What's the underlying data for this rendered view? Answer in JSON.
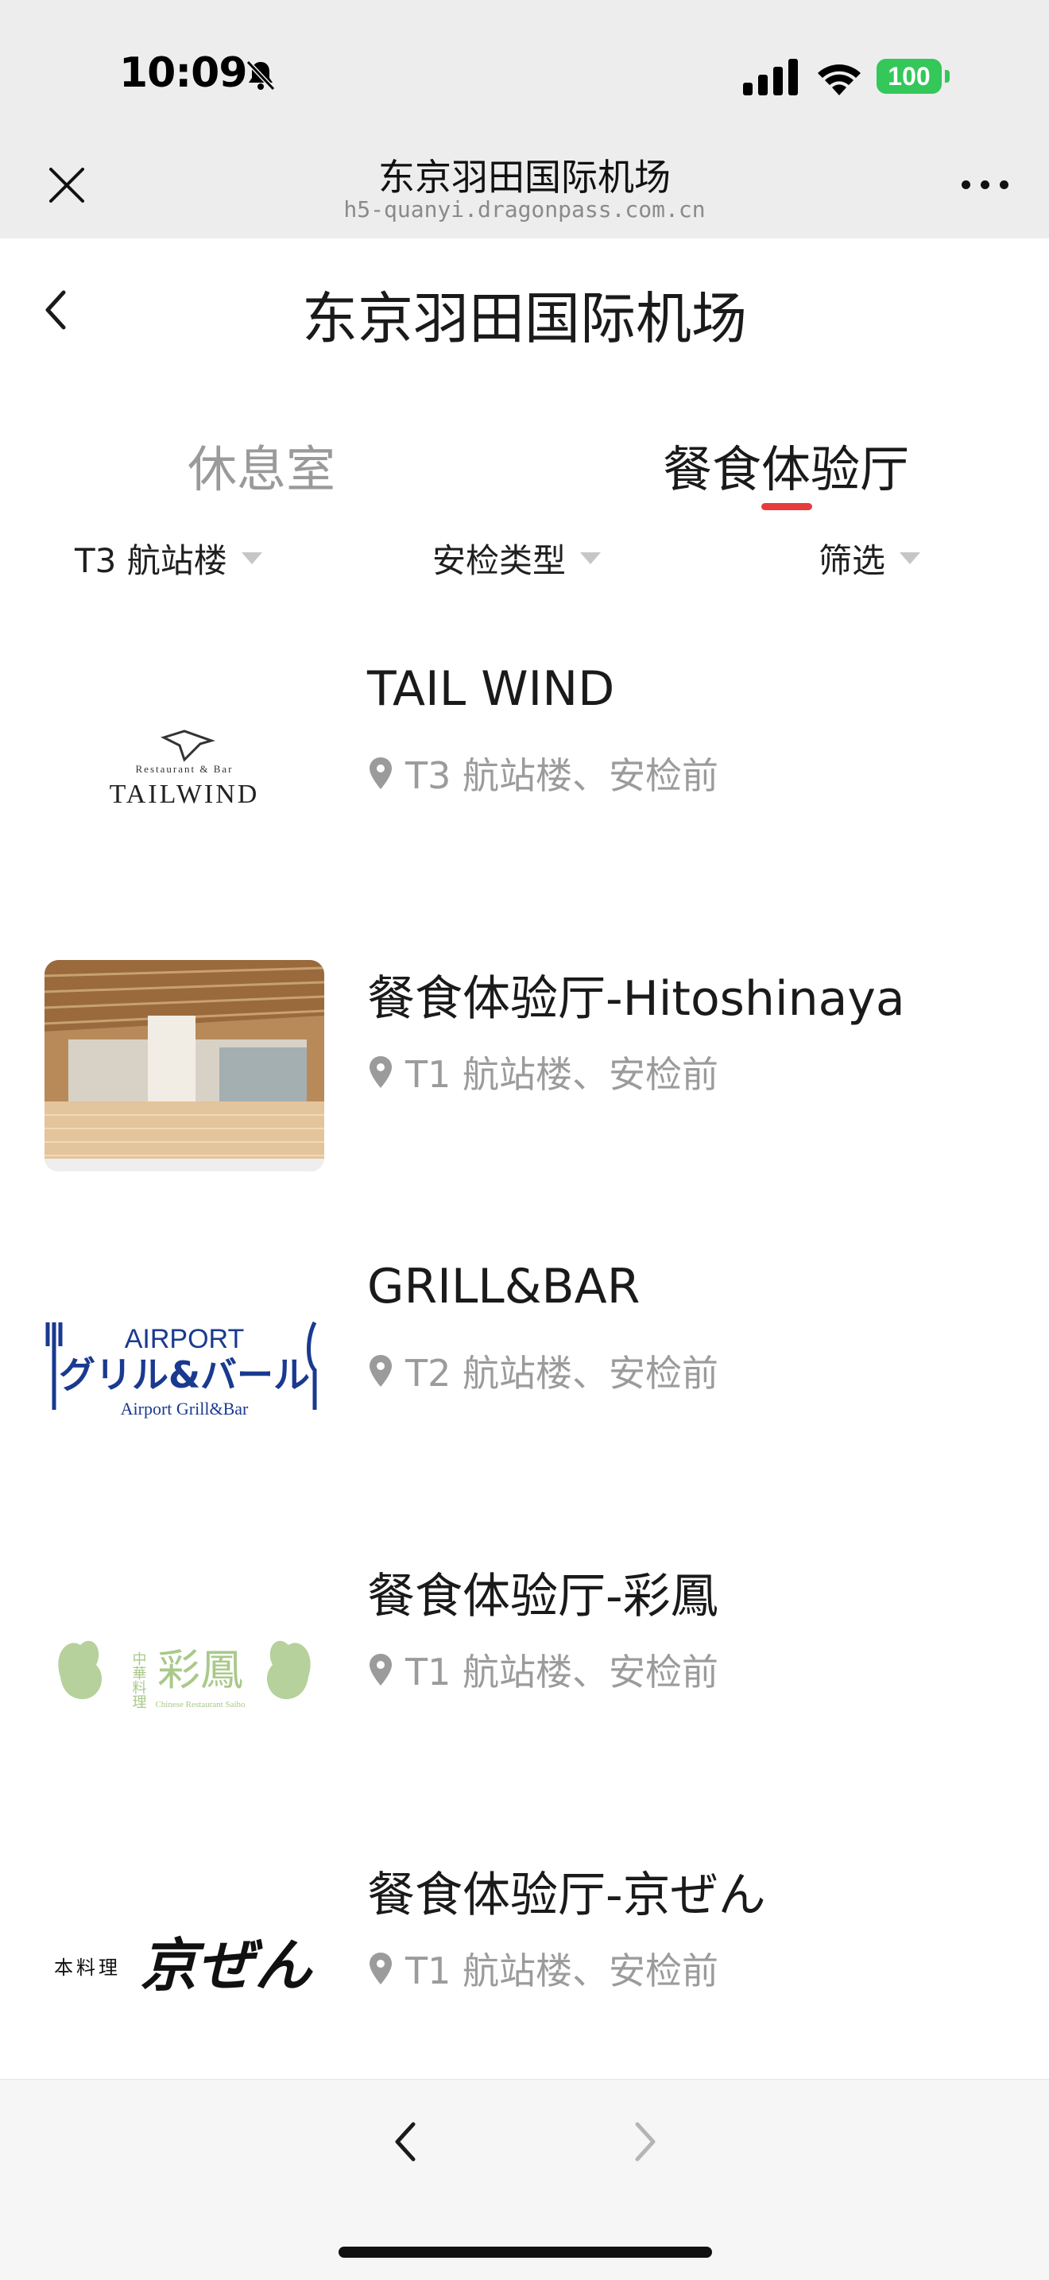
{
  "status_bar": {
    "time": "10:09",
    "battery": "100",
    "icons": [
      "bell-slash-icon",
      "cellular-signal-icon",
      "wifi-icon",
      "battery-icon"
    ]
  },
  "wechat_bar": {
    "title": "东京羽田国际机场",
    "url": "h5-quanyi.dragonpass.com.cn",
    "icons": [
      "close-icon",
      "more-icon"
    ]
  },
  "header": {
    "title": "东京羽田国际机场"
  },
  "tabs": [
    {
      "label": "休息室",
      "active": false
    },
    {
      "label": "餐食体验厅",
      "active": true
    }
  ],
  "filters": [
    {
      "label": "T3 航站楼"
    },
    {
      "label": "安检类型"
    },
    {
      "label": "筛选"
    }
  ],
  "accent_color": "#e83c3c",
  "items": [
    {
      "name": "TAIL WIND",
      "location": "T3 航站楼、安检前",
      "logo": {
        "top": "Restaurant & Bar",
        "brand": "TAILWIND"
      }
    },
    {
      "name": "餐食体验厅-Hitoshinaya",
      "location": "T1 航站楼、安检前",
      "logo": {}
    },
    {
      "name": "GRILL&BAR",
      "location": "T2 航站楼、安检前",
      "logo": {
        "top": "AIRPORT",
        "brand": "グリル&バール",
        "bottom": "Airport Grill&Bar"
      }
    },
    {
      "name": "餐食体验厅-彩鳳",
      "location": "T1 航站楼、安检前",
      "logo": {
        "side": "中華料理",
        "brand": "彩鳳",
        "bottom": "Chinese Restaurant Saiho"
      }
    },
    {
      "name": "餐食体验厅-京ぜん",
      "location": "T1 航站楼、安检前",
      "logo": {
        "side": "本料理",
        "brand": "京ぜん"
      }
    }
  ]
}
